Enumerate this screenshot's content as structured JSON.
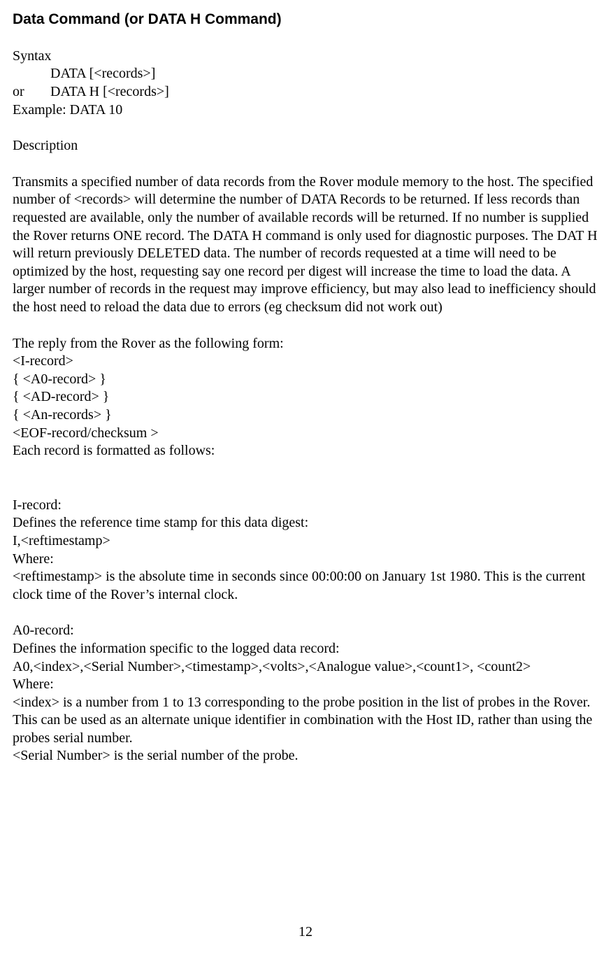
{
  "heading": "Data Command (or DATA H Command)",
  "syntax": {
    "label": "Syntax",
    "line1": "DATA [<records>]",
    "or_label": "or",
    "line2": "DATA H [<records>]",
    "example": "Example: DATA 10"
  },
  "description": {
    "label": "Description",
    "p1": "Transmits a specified number of data records from the Rover module memory to the host. The specified number of <records> will determine the number of DATA Records to be returned. If less records than requested are available, only the number of available records will be returned. If no number is supplied the Rover returns ONE record. The DATA H command is only used for diagnostic purposes. The DAT H will return previously DELETED data. The number of records requested at a time will need to be optimized by the host, requesting say one record per digest will increase the time to load the data. A larger number of records in the request may improve efficiency, but may also lead to inefficiency should the host need to reload the data due to errors (eg checksum did not work out)"
  },
  "reply": {
    "intro": "The reply from the Rover as the following form:",
    "l1": "<I-record>",
    "l2": "{ <A0-record> }",
    "l3": "{ <AD-record> }",
    "l4": "{ <An-records> }",
    "l5": "<EOF-record/checksum >",
    "l6": "Each record is formatted as follows:"
  },
  "irecord": {
    "title": "I-record:",
    "l1": "Defines the reference time stamp for this data digest:",
    "l2": "I,<reftimestamp>",
    "l3": "Where:",
    "l4": "<reftimestamp> is the absolute time in seconds since 00:00:00 on January 1st 1980. This is the current clock time of the Rover’s internal clock."
  },
  "a0record": {
    "title": "A0-record:",
    "l1": "Defines the information specific to the logged data record:",
    "l2": "A0,<index>,<Serial Number>,<timestamp>,<volts>,<Analogue value>,<count1>, <count2>",
    "l3": "Where:",
    "l4": "<index> is a number from 1 to 13 corresponding to the probe position in the list of probes in the Rover. This can be used as an alternate unique identifier in combination with the Host ID, rather than using the probes serial number.",
    "l5": "<Serial Number> is the serial number of the probe."
  },
  "page_number": "12"
}
